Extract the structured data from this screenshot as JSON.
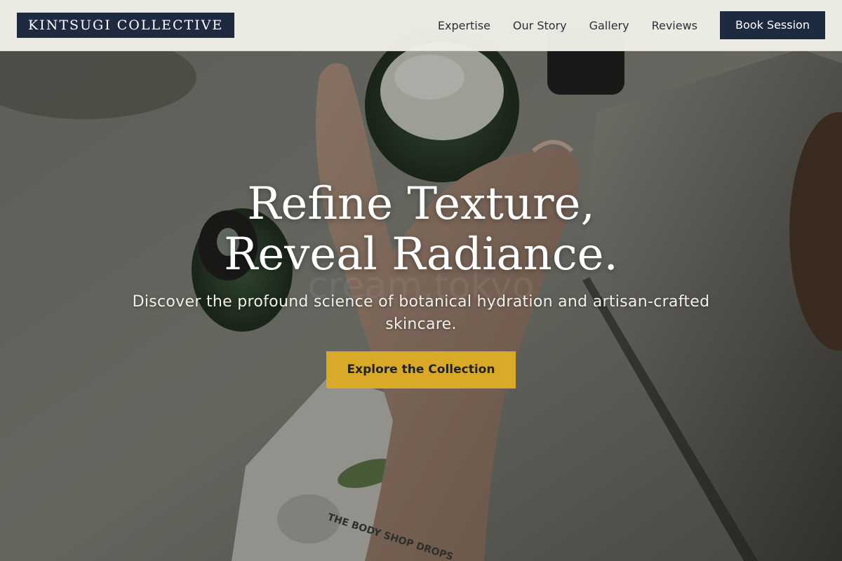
{
  "header": {
    "logo_text": "KINTSUGI COLLECTIVE",
    "nav": [
      {
        "label": "Expertise"
      },
      {
        "label": "Our Story"
      },
      {
        "label": "Gallery"
      },
      {
        "label": "Reviews"
      }
    ],
    "cta_label": "Book Session"
  },
  "hero": {
    "title_line1": "Refine Texture,",
    "title_line2": "Reveal Radiance.",
    "subtitle": "Discover the profound science of botanical hydration and artisan-crafted skincare.",
    "cta_label": "Explore the Collection",
    "photo_watermark": "cream.tokyo",
    "photo_packet_label": "THE BODY SHOP DROPS"
  },
  "colors": {
    "navy": "#1e2a40",
    "gold": "#dba928",
    "header_bg": "#f0efe8"
  }
}
